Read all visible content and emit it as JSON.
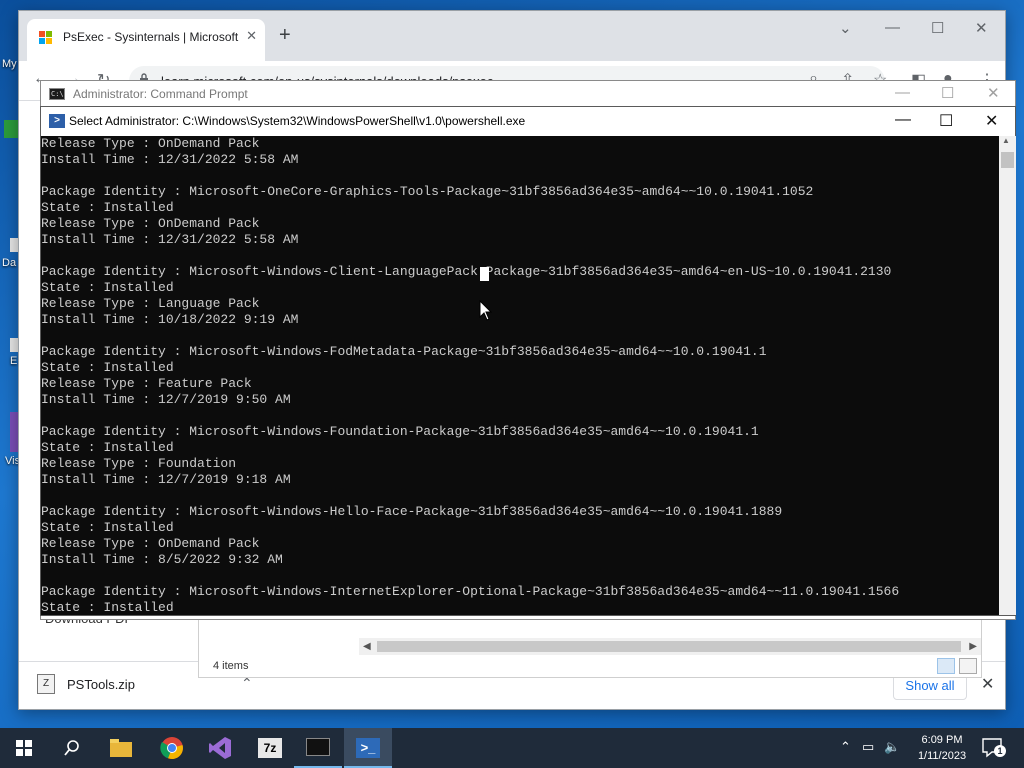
{
  "desktop": {
    "icon_labels": [
      "My",
      "Da",
      "E",
      "Vis"
    ]
  },
  "browser": {
    "tab_title": "PsExec - Sysinternals | Microsoft",
    "tab_close": "✕",
    "new_tab": "+",
    "url": "learn.microsoft.com/en-us/sysinternals/downloads/psexec",
    "side_menu_item": "Download PDF",
    "download": {
      "file_name": "PSTools.zip",
      "show_all": "Show all"
    }
  },
  "explorer": {
    "item_count": "4 items"
  },
  "cmd": {
    "title": "Administrator: Command Prompt"
  },
  "powershell": {
    "title": "Select Administrator: C:\\Windows\\System32\\WindowsPowerShell\\v1.0\\powershell.exe",
    "lines": [
      "Release Type : OnDemand Pack",
      "Install Time : 12/31/2022 5:58 AM",
      "",
      "Package Identity : Microsoft-OneCore-Graphics-Tools-Package~31bf3856ad364e35~amd64~~10.0.19041.1052",
      "State : Installed",
      "Release Type : OnDemand Pack",
      "Install Time : 12/31/2022 5:58 AM",
      "",
      "Package Identity : Microsoft-Windows-Client-LanguagePack-Package~31bf3856ad364e35~amd64~en-US~10.0.19041.2130",
      "State : Installed",
      "Release Type : Language Pack",
      "Install Time : 10/18/2022 9:19 AM",
      "",
      "Package Identity : Microsoft-Windows-FodMetadata-Package~31bf3856ad364e35~amd64~~10.0.19041.1",
      "State : Installed",
      "Release Type : Feature Pack",
      "Install Time : 12/7/2019 9:50 AM",
      "",
      "Package Identity : Microsoft-Windows-Foundation-Package~31bf3856ad364e35~amd64~~10.0.19041.1",
      "State : Installed",
      "Release Type : Foundation",
      "Install Time : 12/7/2019 9:18 AM",
      "",
      "Package Identity : Microsoft-Windows-Hello-Face-Package~31bf3856ad364e35~amd64~~10.0.19041.1889",
      "State : Installed",
      "Release Type : OnDemand Pack",
      "Install Time : 8/5/2022 9:32 AM",
      "",
      "Package Identity : Microsoft-Windows-InternetExplorer-Optional-Package~31bf3856ad364e35~amd64~~11.0.19041.1566",
      "State : Installed"
    ]
  },
  "taskbar": {
    "apps": [
      "start-icon",
      "search-icon",
      "file-explorer-icon",
      "chrome-icon",
      "visual-studio-icon",
      "7zip-icon",
      "cmd-icon",
      "powershell-icon"
    ],
    "clock_time": "6:09 PM",
    "clock_date": "1/11/2023",
    "notification_count": "1"
  },
  "colors": {
    "console_bg": "#0c0c0c",
    "console_fg": "#cccccc",
    "taskbar_bg": "#1f2b3a",
    "desktop_blue": "#1e78d0"
  }
}
